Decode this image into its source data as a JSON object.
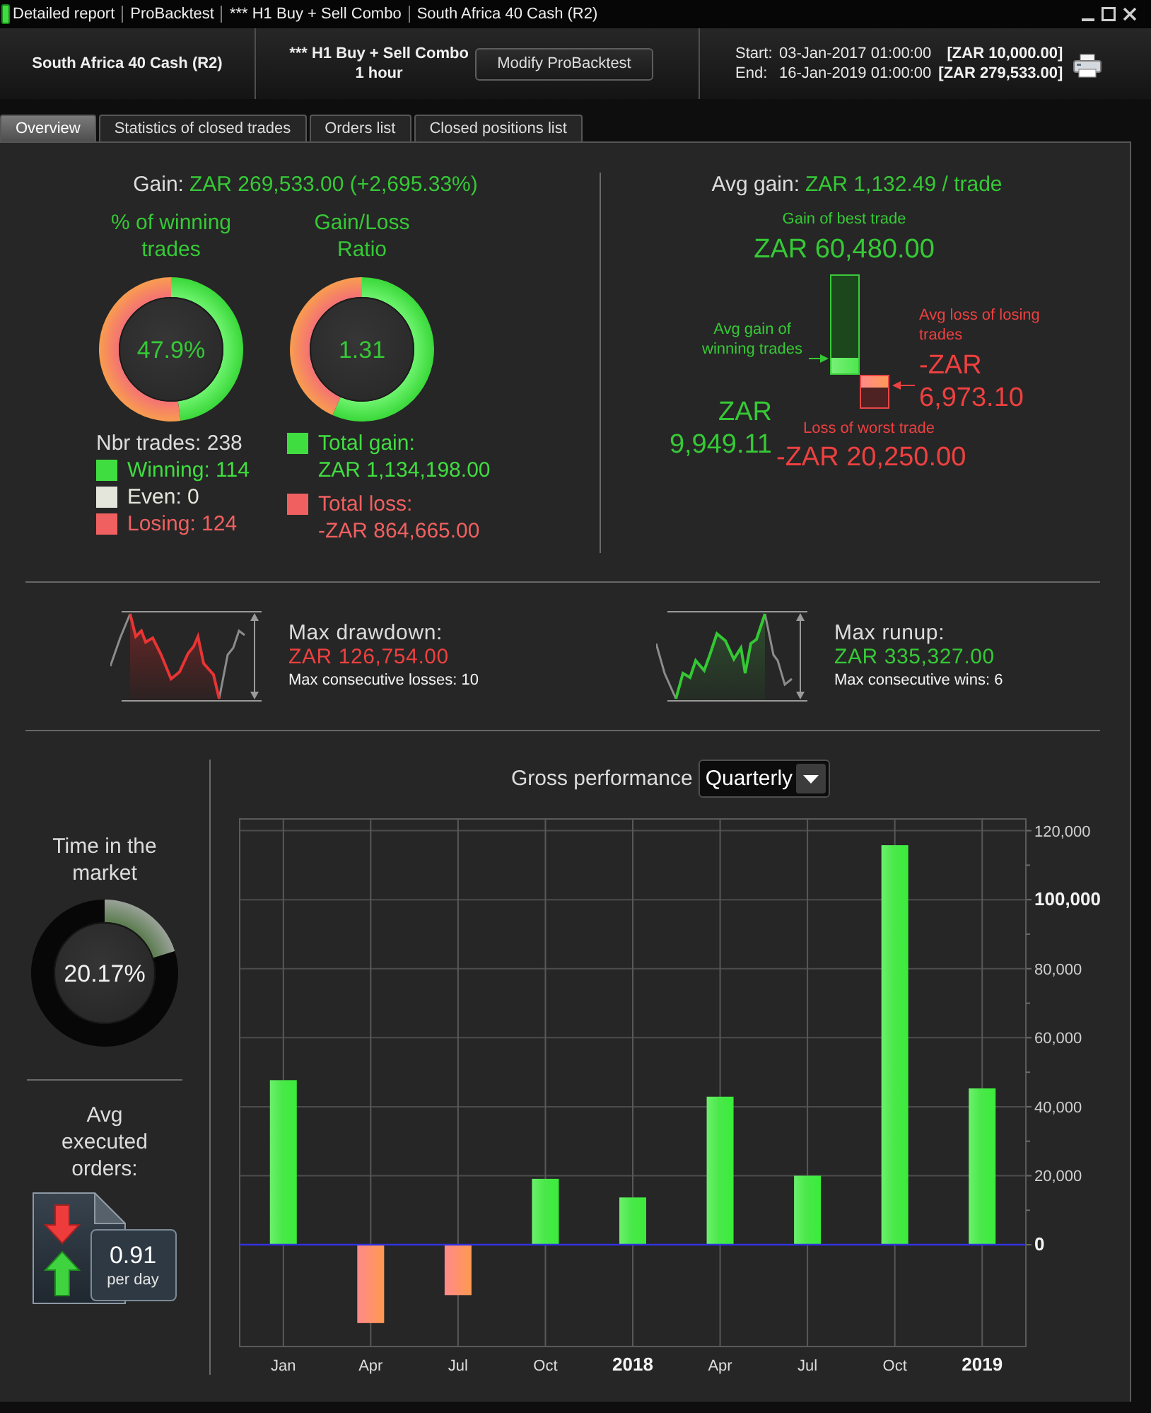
{
  "title_bar": {
    "segments": [
      "Detailed report",
      "ProBacktest",
      "*** H1 Buy + Sell Combo",
      "South Africa 40 Cash (R2)"
    ]
  },
  "header": {
    "instrument": "South Africa 40 Cash (R2)",
    "system": "*** H1 Buy + Sell Combo",
    "timeframe": "1 hour",
    "modify_button": "Modify ProBacktest",
    "period": [
      {
        "label": "Start:",
        "date": "03-Jan-2017 01:00:00",
        "capital": "[ZAR 10,000.00]"
      },
      {
        "label": "End:",
        "date": "16-Jan-2019 01:00:00",
        "capital": "[ZAR 279,533.00]"
      }
    ]
  },
  "tabs": [
    {
      "label": "Overview",
      "selected": true
    },
    {
      "label": "Statistics of closed trades",
      "selected": false
    },
    {
      "label": "Orders list",
      "selected": false
    },
    {
      "label": "Closed positions list",
      "selected": false
    }
  ],
  "gain": {
    "label": "Gain:",
    "value": "ZAR 269,533.00 (+2,695.33%)"
  },
  "gauges": [
    {
      "title": "% of winning trades",
      "value": "47.9%",
      "chart_data": {
        "type": "donut",
        "values": [
          47.9,
          52.1
        ]
      }
    },
    {
      "title": "Gain/Loss Ratio",
      "value": "1.31",
      "chart_data": {
        "type": "donut",
        "values": [
          56.7,
          43.3
        ]
      }
    }
  ],
  "trade_counts": {
    "total": "Nbr trades: 238",
    "legend": [
      {
        "label": "Winning: 114",
        "color": "#40dd40"
      },
      {
        "label": "Even: 0",
        "color": "#e4e6dc"
      },
      {
        "label": "Losing: 124",
        "color": "#f06060"
      }
    ]
  },
  "totals": [
    {
      "label": "Total gain:",
      "value": "ZAR 1,134,198.00",
      "color": "#40dd40"
    },
    {
      "label": "Total loss:",
      "value": "-ZAR 864,665.00",
      "color": "#f06060"
    }
  ],
  "avg_gain": {
    "label": "Avg gain:",
    "value": "ZAR 1,132.49 / trade",
    "best_trade": {
      "label": "Gain of best trade",
      "value": "ZAR 60,480.00"
    },
    "avg_winning": {
      "label": "Avg gain of winning trades",
      "value": "ZAR 9,949.11",
      "level": 0.164
    },
    "avg_losing": {
      "label": "Avg loss of losing trades",
      "value": "-ZAR 6,973.10",
      "level": 0.344
    },
    "worst_trade": {
      "label": "Loss of worst trade",
      "value": "-ZAR 20,250.00"
    }
  },
  "extremes": [
    {
      "kind": "drawdown",
      "title": "Max drawdown:",
      "value": "ZAR 126,754.00",
      "detail": "Max consecutive losses: 10"
    },
    {
      "kind": "runup",
      "title": "Max runup:",
      "value": "ZAR 335,327.00",
      "detail": "Max consecutive wins: 6"
    }
  ],
  "time_in_market": {
    "title": "Time in the market",
    "value": "20.17%",
    "chart_data": {
      "type": "donut",
      "values": [
        20.17,
        79.83
      ]
    }
  },
  "avg_orders": {
    "title": "Avg executed orders:",
    "value": "0.91",
    "unit": "per day"
  },
  "performance": {
    "period_select": {
      "value": "Quarterly"
    },
    "chart_data": {
      "type": "bar",
      "title": "Gross performance",
      "categories": [
        "Jan",
        "Apr",
        "Jul",
        "Oct",
        "2018",
        "Apr",
        "Jul",
        "Oct",
        "2019"
      ],
      "values": [
        47700,
        -22700,
        -14600,
        19100,
        13700,
        42900,
        20000,
        115800,
        45300
      ],
      "ylim": [
        -29500,
        123400
      ],
      "yticks": [
        {
          "value": 0,
          "label": "0"
        },
        {
          "value": 20000,
          "label": "20,000"
        },
        {
          "value": 40000,
          "label": "40,000"
        },
        {
          "value": 60000,
          "label": "60,000"
        },
        {
          "value": 80000,
          "label": "80,000"
        },
        {
          "value": 100000,
          "label": "100,000"
        },
        {
          "value": 120000,
          "label": "120,000"
        }
      ],
      "grid": true,
      "ref_lines": [
        {
          "axis": "y",
          "value": 0,
          "color": "#3232e0"
        }
      ]
    }
  }
}
